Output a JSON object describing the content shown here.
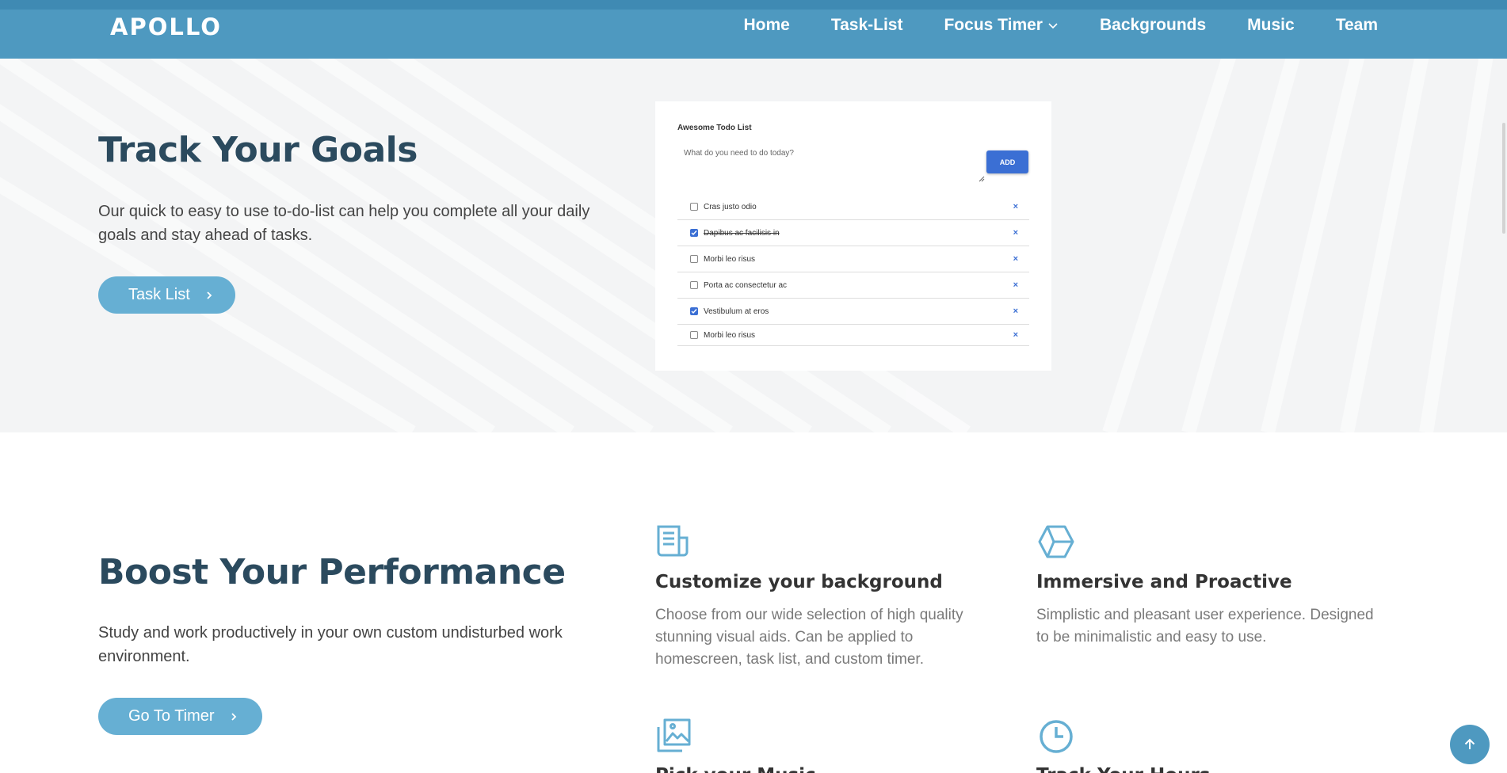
{
  "header": {
    "logo": "APOLLO",
    "nav": [
      "Home",
      "Task-List",
      "Focus Timer",
      "Backgrounds",
      "Music",
      "Team"
    ]
  },
  "hero": {
    "title": "Track Your Goals",
    "description": "Our quick to easy to use to-do-list can help you complete all your daily goals and stay ahead of tasks.",
    "button": "Task List"
  },
  "todo_card": {
    "title": "Awesome Todo List",
    "input_placeholder": "What do you need to do today?",
    "add_label": "ADD",
    "delete_glyph": "×",
    "items": [
      {
        "text": "Cras justo odio",
        "checked": false,
        "done": false
      },
      {
        "text": "Dapibus ac facilisis in",
        "checked": true,
        "done": true
      },
      {
        "text": "Morbi leo risus",
        "checked": false,
        "done": false
      },
      {
        "text": "Porta ac consectetur ac",
        "checked": false,
        "done": false
      },
      {
        "text": "Vestibulum at eros",
        "checked": true,
        "done": false
      },
      {
        "text": "Morbi leo risus",
        "checked": false,
        "done": false
      }
    ]
  },
  "features_section": {
    "title": "Boost Your Performance",
    "description": "Study and work productively in your own custom undisturbed work environment.",
    "button": "Go To Timer",
    "features": [
      {
        "icon": "document-icon",
        "title": "Customize your background",
        "description": "Choose from our wide selection of high quality stunning visual aids. Can be applied to homescreen, task list, and custom timer."
      },
      {
        "icon": "hexagon-icon",
        "title": "Immersive and Proactive",
        "description": "Simplistic and pleasant user experience. Designed to be minimalistic and easy to use."
      },
      {
        "icon": "images-icon",
        "title": "Pick your Music",
        "description": ""
      },
      {
        "icon": "clock-icon",
        "title": "Track Your Hours",
        "description": ""
      }
    ]
  },
  "colors": {
    "header_bg": "#4e99c0",
    "heading": "#2b4a5e",
    "button": "#66afd3",
    "accent_blue": "#3b6fd4",
    "icon": "#66afd3"
  }
}
